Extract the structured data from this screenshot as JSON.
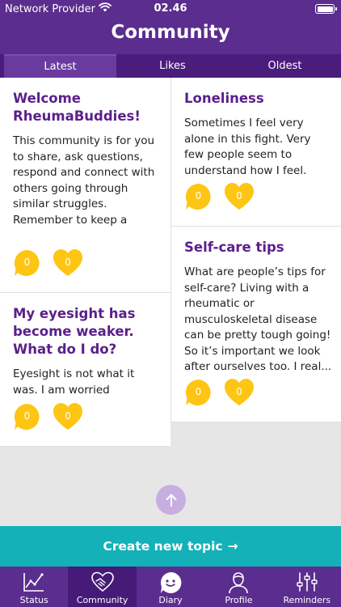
{
  "status_bar": {
    "carrier": "Network Provider",
    "time": "02.46"
  },
  "header": {
    "title": "Community"
  },
  "tabs": [
    {
      "label": "Latest",
      "active": true
    },
    {
      "label": "Likes",
      "active": false
    },
    {
      "label": "Oldest",
      "active": false
    }
  ],
  "posts_left": [
    {
      "title": "Welcome RheumaBuddies!",
      "body": "This community is for you to share, ask questions, respond and connect with others going through similar struggles. Remember to keep a respectful tone and be c...",
      "comments": "0",
      "likes": "0"
    },
    {
      "title": "My eyesight has become weaker. What do I do?",
      "body": "Eyesight is not what it was. I am worried",
      "comments": "0",
      "likes": "0"
    }
  ],
  "posts_right": [
    {
      "title": "Loneliness",
      "body": "Sometimes I feel very alone in this fight. Very few people seem to understand how I feel.",
      "comments": "0",
      "likes": "0"
    },
    {
      "title": "Self-care tips",
      "body": "What are people’s tips for self-care? Living with a rheumatic or musculoskeletal disease can be pretty tough going! So it’s important we look after ourselves too. I real...",
      "comments": "0",
      "likes": "0"
    }
  ],
  "create_button": {
    "label": "Create new topic",
    "arrow": "→"
  },
  "bottom_nav": [
    {
      "label": "Status",
      "icon": "chart-icon",
      "active": false
    },
    {
      "label": "Community",
      "icon": "handshake-heart-icon",
      "active": true
    },
    {
      "label": "Diary",
      "icon": "chat-smile-icon",
      "active": false
    },
    {
      "label": "Profile",
      "icon": "person-icon",
      "active": false
    },
    {
      "label": "Reminders",
      "icon": "sliders-icon",
      "active": false
    }
  ],
  "colors": {
    "brand_purple": "#5b2d8e",
    "title_purple": "#5b1f8a",
    "accent_yellow": "#fec513",
    "teal": "#14b1b9"
  }
}
